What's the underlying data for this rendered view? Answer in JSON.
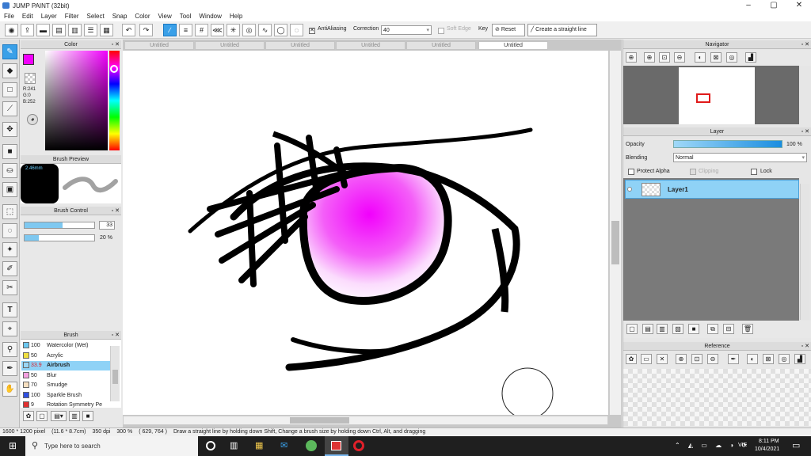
{
  "app": {
    "title": "JUMP PAINT (32bit)"
  },
  "menu": [
    "File",
    "Edit",
    "Layer",
    "Filter",
    "Select",
    "Snap",
    "Color",
    "View",
    "Tool",
    "Window",
    "Help"
  ],
  "toolbar": {
    "antialias": "AntiAliasing",
    "correction_label": "Correction",
    "correction_value": "40",
    "soft_edge": "Soft Edge",
    "key": "Key",
    "reset": "Reset",
    "straight": "Create a straight line"
  },
  "tabs": [
    "Untitled",
    "Untitled",
    "Untitled",
    "Untitled",
    "Untitled",
    "Untitled"
  ],
  "color": {
    "title": "Color",
    "r": "R:241",
    "g": "G:0",
    "b": "B:252",
    "primary": "#f100fc"
  },
  "brush_preview": {
    "title": "Brush Preview",
    "size": "2.46mm"
  },
  "brush_control": {
    "title": "Brush Control",
    "size": "33",
    "opacity": "20 %",
    "size_level": 0.55,
    "opacity_level": 0.2
  },
  "brush": {
    "title": "Brush",
    "items": [
      {
        "size": "100",
        "name": "Watercolor (Wet)",
        "color": "#6cc8f0"
      },
      {
        "size": "50",
        "name": "Acrylic",
        "color": "#f0e040"
      },
      {
        "size": "33.9",
        "name": "Airbrush",
        "color": "#9ad6f5"
      },
      {
        "size": "50",
        "name": "Blur",
        "color": "#f4a0e0"
      },
      {
        "size": "70",
        "name": "Smudge",
        "color": "#f8e0c0"
      },
      {
        "size": "100",
        "name": "Sparkle Brush",
        "color": "#3050e0"
      },
      {
        "size": "9",
        "name": "Rotation Symmetry Pe",
        "color": "#e03030"
      }
    ]
  },
  "navigator": {
    "title": "Navigator"
  },
  "layer": {
    "title": "Layer",
    "opacity_label": "Opacity",
    "opacity_value": "100 %",
    "blending_label": "Blending",
    "blending_value": "Normal",
    "protect_alpha": "Protect Alpha",
    "clipping": "Clipping",
    "lock": "Lock",
    "layer_name": "Layer1"
  },
  "reference": {
    "title": "Reference"
  },
  "status": {
    "size": "1600 * 1200 pixel",
    "cm": "(11.6 * 8.7cm)",
    "dpi": "350 dpi",
    "zoom": "300 %",
    "coords": "( 629, 764 )",
    "hint": "Draw a straight line by holding down Shift, Change a brush size by holding down Ctrl, Alt, and dragging"
  },
  "taskbar": {
    "search": "Type here to search",
    "lang": "VIE",
    "time": "8:11 PM",
    "date": "10/4/2021"
  },
  "colors": {
    "accent": "#3aa0e8",
    "canvas": "#ffffff",
    "eye": "#f100fc"
  }
}
